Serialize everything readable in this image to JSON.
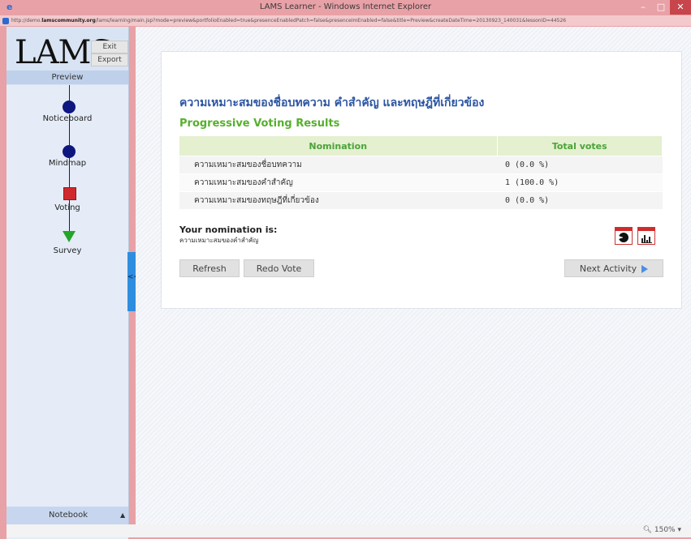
{
  "window": {
    "title": "LAMS Learner - Windows Internet Explorer",
    "url_prefix": "http://demo.",
    "url_domain": "lamscommunity.org",
    "url_rest": "/lams/learning/main.jsp?mode=preview&portfolioEnabled=true&presenceEnabledPatch=false&presenceImEnabled=false&title=Preview&createDateTime=20130923_140031&lessonID=44526"
  },
  "sidebar": {
    "logo": "LAMS",
    "exit_label": "Exit",
    "export_label": "Export",
    "preview_label": "Preview",
    "activities": [
      {
        "label": "Noticeboard",
        "shape": "circle"
      },
      {
        "label": "Mindmap",
        "shape": "circle"
      },
      {
        "label": "Voting",
        "shape": "square"
      },
      {
        "label": "Survey",
        "shape": "triangle"
      }
    ],
    "notebook_label": "Notebook",
    "notebook_arrow": "▲",
    "collapse_glyph": "<<"
  },
  "content": {
    "title": "ความเหมาะสมของชื่อบทความ คำสำคัญ และทฤษฎีที่เกี่ยวข้อง",
    "subtitle": "Progressive Voting Results",
    "table": {
      "headers": [
        "Nomination",
        "Total votes"
      ],
      "rows": [
        {
          "nomination": "ความเหมาะสมของชื่อบทความ",
          "votes": "0 (0.0 %)"
        },
        {
          "nomination": "ความเหมาะสมของคำสำคัญ",
          "votes": "1 (100.0 %)"
        },
        {
          "nomination": "ความเหมาะสมของทฤษฎีที่เกี่ยวข้อง",
          "votes": "0 (0.0 %)"
        }
      ]
    },
    "your_nomination_label": "Your nomination is:",
    "your_nomination_value": "ความเหมาะสมของคำสำคัญ",
    "refresh_label": "Refresh",
    "redo_label": "Redo Vote",
    "next_label": "Next Activity"
  },
  "statusbar": {
    "zoom": "150%"
  },
  "colors": {
    "title_blue": "#2b55a2",
    "results_green": "#56b02c",
    "window_frame": "#e8a1a6"
  }
}
